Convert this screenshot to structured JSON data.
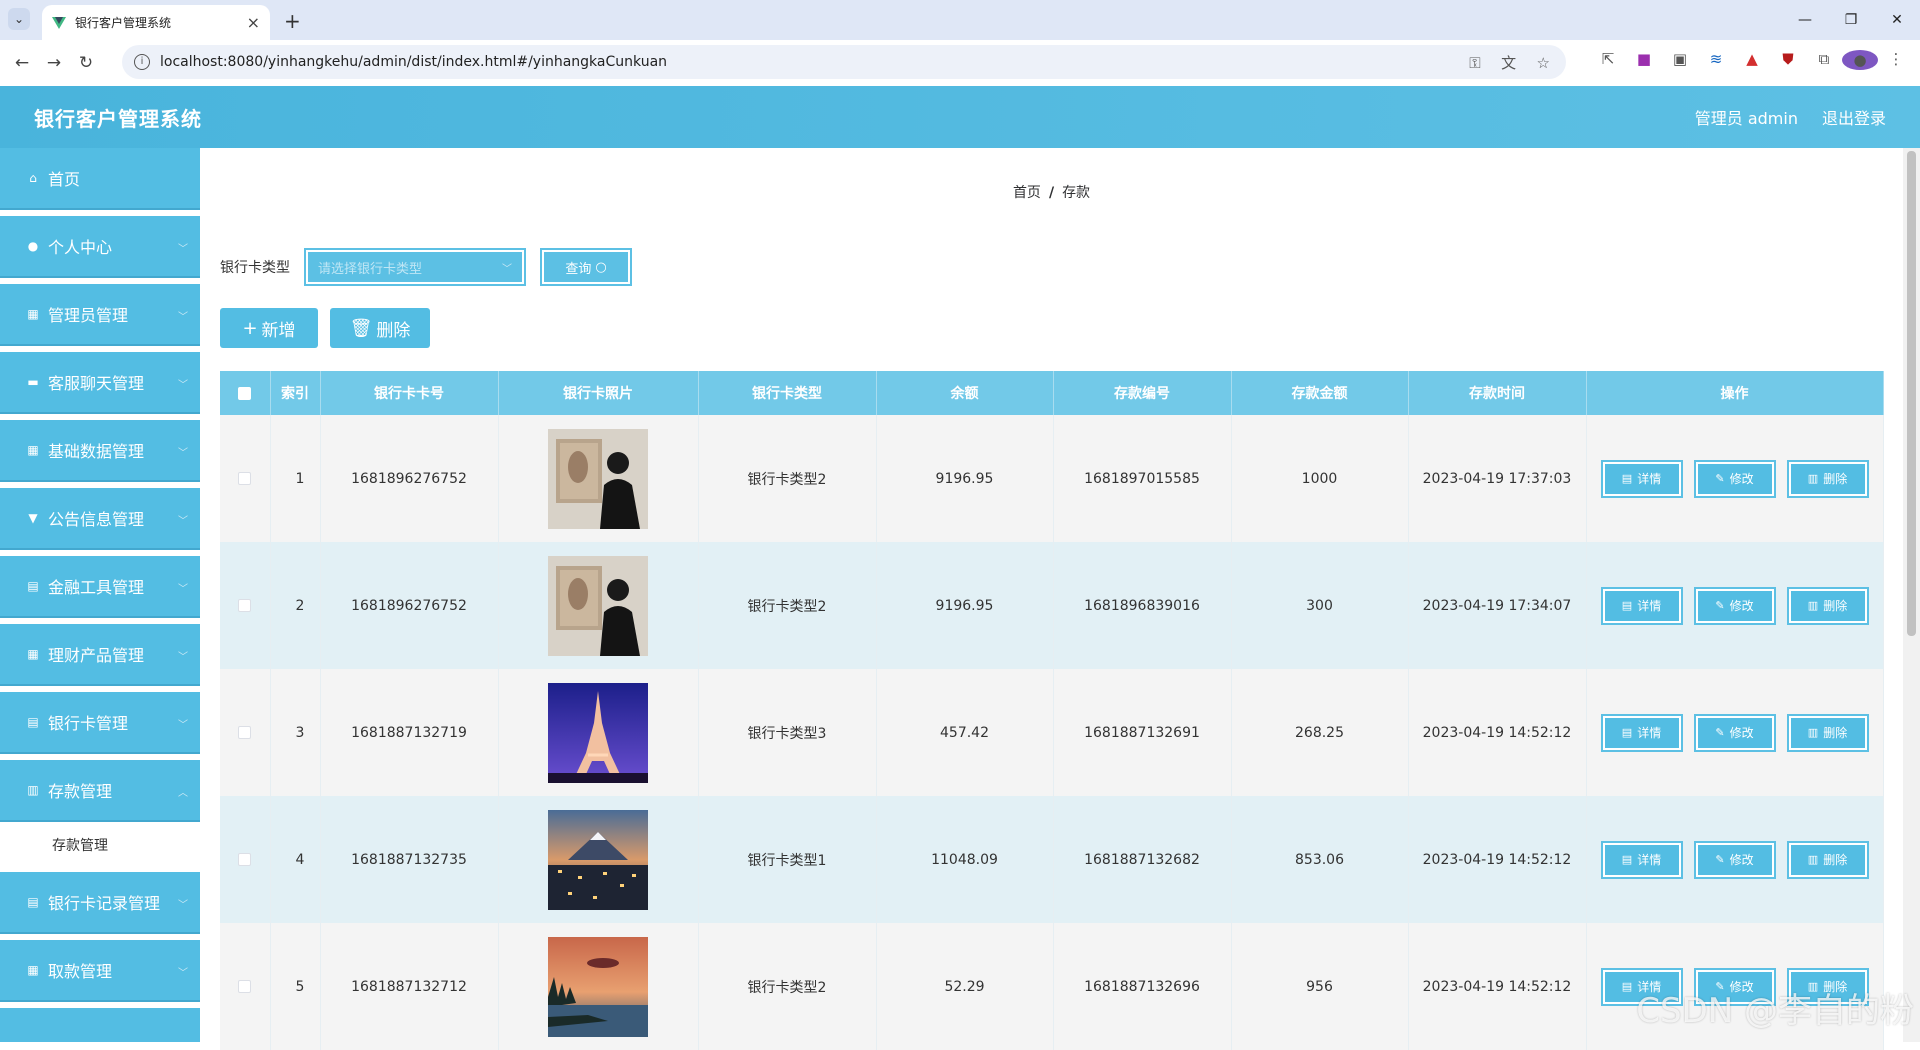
{
  "browser": {
    "tab_title": "银行客户管理系统",
    "url": "localhost:8080/yinhangkehu/admin/dist/index.html#/yinhangkaCunkuan"
  },
  "header": {
    "title": "银行客户管理系统",
    "user": "管理员 admin",
    "logout": "退出登录"
  },
  "sidebar": {
    "items": [
      {
        "label": "首页",
        "icon": "home-icon"
      },
      {
        "label": "个人中心",
        "icon": "user-icon"
      },
      {
        "label": "管理员管理",
        "icon": "grid-icon"
      },
      {
        "label": "客服聊天管理",
        "icon": "chat-icon"
      },
      {
        "label": "基础数据管理",
        "icon": "grid-icon"
      },
      {
        "label": "公告信息管理",
        "icon": "notice-icon"
      },
      {
        "label": "金融工具管理",
        "icon": "doc-icon"
      },
      {
        "label": "理财产品管理",
        "icon": "grid-icon"
      },
      {
        "label": "银行卡管理",
        "icon": "doc-icon"
      },
      {
        "label": "存款管理",
        "icon": "chart-icon"
      },
      {
        "label": "银行卡记录管理",
        "icon": "doc-icon"
      },
      {
        "label": "取款管理",
        "icon": "grid-icon"
      }
    ],
    "active_sub": "存款管理"
  },
  "breadcrumb": {
    "home": "首页",
    "sep": "/",
    "current": "存款"
  },
  "search": {
    "label": "银行卡类型",
    "placeholder": "请选择银行卡类型",
    "query_label": "查询"
  },
  "actions": {
    "add_label": "新增",
    "delete_label": "删除"
  },
  "table": {
    "headers": [
      "索引",
      "银行卡卡号",
      "银行卡照片",
      "银行卡类型",
      "余额",
      "存款编号",
      "存款金额",
      "存款时间",
      "操作"
    ],
    "op_labels": {
      "detail": "详情",
      "edit": "修改",
      "delete": "删除"
    },
    "rows": [
      {
        "index": "1",
        "card_no": "1681896276752",
        "photo": "portrait-photo",
        "card_type": "银行卡类型2",
        "balance": "9196.95",
        "deposit_no": "1681897015585",
        "amount": "1000",
        "time": "2023-04-19 17:37:03"
      },
      {
        "index": "2",
        "card_no": "1681896276752",
        "photo": "portrait-photo",
        "card_type": "银行卡类型2",
        "balance": "9196.95",
        "deposit_no": "1681896839016",
        "amount": "300",
        "time": "2023-04-19 17:34:07"
      },
      {
        "index": "3",
        "card_no": "1681887132719",
        "photo": "eiffel-tower-photo",
        "card_type": "银行卡类型3",
        "balance": "457.42",
        "deposit_no": "1681887132691",
        "amount": "268.25",
        "time": "2023-04-19 14:52:12"
      },
      {
        "index": "4",
        "card_no": "1681887132735",
        "photo": "city-mountain-photo",
        "card_type": "银行卡类型1",
        "balance": "11048.09",
        "deposit_no": "1681887132682",
        "amount": "853.06",
        "time": "2023-04-19 14:52:12"
      },
      {
        "index": "5",
        "card_no": "1681887132712",
        "photo": "lake-sunset-photo",
        "card_type": "银行卡类型2",
        "balance": "52.29",
        "deposit_no": "1681887132696",
        "amount": "956",
        "time": "2023-04-19 14:52:12"
      }
    ]
  },
  "watermark": "CSDN @李自的粉"
}
